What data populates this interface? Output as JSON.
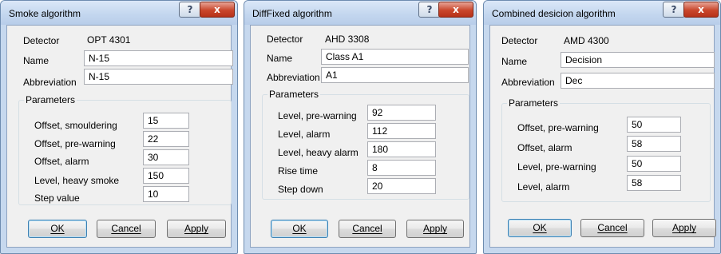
{
  "dialogs": [
    {
      "title": "Smoke algorithm",
      "help_glyph": "?",
      "close_glyph": "x",
      "detector_label": "Detector",
      "detector_value": "OPT 4301",
      "name_label": "Name",
      "name_value": "N-15",
      "abbreviation_label": "Abbreviation",
      "abbreviation_value": "N-15",
      "parameters_label": "Parameters",
      "parameters": [
        {
          "label": "Offset, smouldering",
          "value": "15"
        },
        {
          "label": "Offset, pre-warning",
          "value": "22"
        },
        {
          "label": "Offset, alarm",
          "value": "30"
        },
        {
          "label": "Level, heavy smoke",
          "value": "150"
        },
        {
          "label": "Step value",
          "value": "10"
        }
      ],
      "ok_label": "OK",
      "cancel_label": "Cancel",
      "apply_label": "Apply"
    },
    {
      "title": "DiffFixed algorithm",
      "help_glyph": "?",
      "close_glyph": "x",
      "detector_label": "Detector",
      "detector_value": "AHD 3308",
      "name_label": "Name",
      "name_value": "Class A1",
      "abbreviation_label": "Abbreviation",
      "abbreviation_value": "A1",
      "parameters_label": "Parameters",
      "parameters": [
        {
          "label": "Level, pre-warning",
          "value": "92"
        },
        {
          "label": "Level, alarm",
          "value": "112"
        },
        {
          "label": "Level, heavy alarm",
          "value": "180"
        },
        {
          "label": "Rise time",
          "value": "8"
        },
        {
          "label": "Step down",
          "value": "20"
        }
      ],
      "ok_label": "OK",
      "cancel_label": "Cancel",
      "apply_label": "Apply"
    },
    {
      "title": "Combined desicion algorithm",
      "help_glyph": "?",
      "close_glyph": "x",
      "detector_label": "Detector",
      "detector_value": "AMD 4300",
      "name_label": "Name",
      "name_value": "Decision",
      "abbreviation_label": "Abbreviation",
      "abbreviation_value": "Dec",
      "parameters_label": "Parameters",
      "parameters": [
        {
          "label": "Offset, pre-warning",
          "value": "50"
        },
        {
          "label": "Offset, alarm",
          "value": "58"
        },
        {
          "label": "Level, pre-warning",
          "value": "50"
        },
        {
          "label": "Level, alarm",
          "value": "58"
        }
      ],
      "ok_label": "OK",
      "cancel_label": "Cancel",
      "apply_label": "Apply"
    }
  ]
}
